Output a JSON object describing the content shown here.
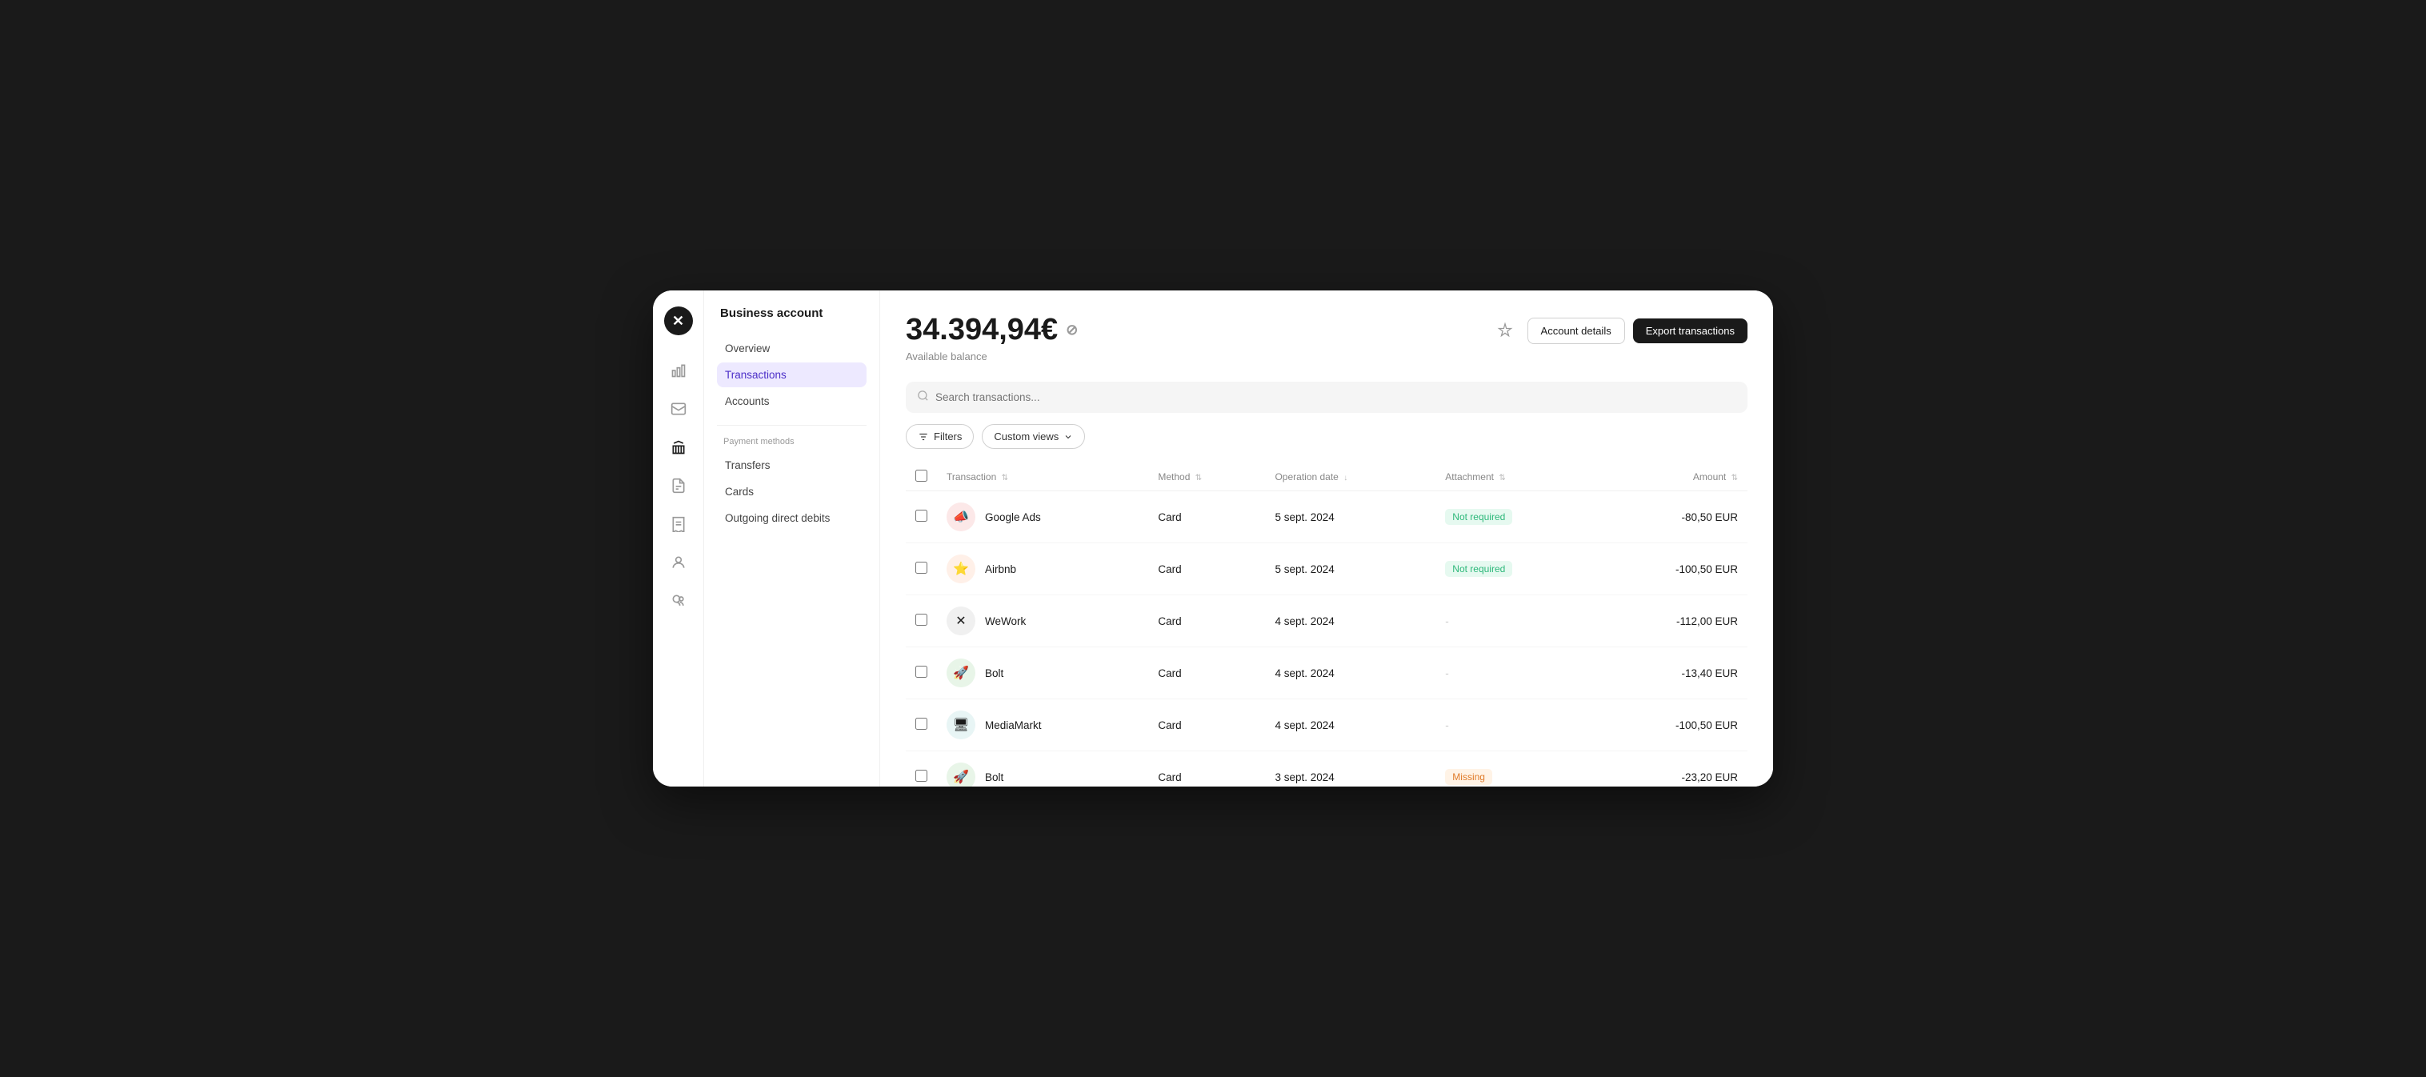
{
  "app": {
    "logo": "✕",
    "account_title": "Business account"
  },
  "rail_icons": [
    {
      "name": "chart-icon",
      "symbol": "📊",
      "active": false
    },
    {
      "name": "mail-icon",
      "symbol": "✉",
      "active": false
    },
    {
      "name": "bank-icon",
      "symbol": "🏦",
      "active": true
    },
    {
      "name": "file-icon",
      "symbol": "📋",
      "active": false
    },
    {
      "name": "receipt-icon",
      "symbol": "🧾",
      "active": false
    },
    {
      "name": "user-icon",
      "symbol": "👤",
      "active": false
    },
    {
      "name": "coins-icon",
      "symbol": "💰",
      "active": false
    }
  ],
  "sidebar": {
    "header": "Business account",
    "section1_label": "",
    "nav_items": [
      {
        "label": "Overview",
        "active": false,
        "id": "overview"
      },
      {
        "label": "Transactions",
        "active": true,
        "id": "transactions"
      },
      {
        "label": "Accounts",
        "active": false,
        "id": "accounts"
      }
    ],
    "section2_label": "Payment methods",
    "payment_items": [
      {
        "label": "Transfers",
        "active": false,
        "id": "transfers"
      },
      {
        "label": "Cards",
        "active": false,
        "id": "cards"
      },
      {
        "label": "Outgoing direct debits",
        "active": false,
        "id": "direct-debits"
      }
    ]
  },
  "main": {
    "balance": "34.394,94€",
    "balance_label": "Available balance",
    "btn_account_details": "Account details",
    "btn_export": "Export transactions",
    "search_placeholder": "Search transactions...",
    "btn_filters": "Filters",
    "btn_custom_views": "Custom views",
    "table": {
      "columns": [
        {
          "label": "Transaction",
          "sort": true
        },
        {
          "label": "Method",
          "sort": true
        },
        {
          "label": "Operation date",
          "sort": true,
          "sort_direction": "desc"
        },
        {
          "label": "Attachment",
          "sort": true
        },
        {
          "label": "Amount",
          "sort": true
        }
      ],
      "rows": [
        {
          "id": 1,
          "merchant": "Google Ads",
          "icon_bg": "#fce8e8",
          "icon": "📣",
          "method": "Card",
          "date": "5 sept. 2024",
          "attachment": "Not required",
          "attachment_type": "not-required",
          "amount": "-80,50 EUR"
        },
        {
          "id": 2,
          "merchant": "Airbnb",
          "icon_bg": "#fff0e8",
          "icon": "⭐",
          "method": "Card",
          "date": "5 sept. 2024",
          "attachment": "Not required",
          "attachment_type": "not-required",
          "amount": "-100,50 EUR"
        },
        {
          "id": 3,
          "merchant": "WeWork",
          "icon_bg": "#f0f0f0",
          "icon": "✕",
          "method": "Card",
          "date": "4 sept. 2024",
          "attachment": "-",
          "attachment_type": "dash",
          "amount": "-112,00 EUR"
        },
        {
          "id": 4,
          "merchant": "Bolt",
          "icon_bg": "#e8f5e8",
          "icon": "🚀",
          "method": "Card",
          "date": "4 sept. 2024",
          "attachment": "-",
          "attachment_type": "dash",
          "amount": "-13,40 EUR"
        },
        {
          "id": 5,
          "merchant": "MediaMarkt",
          "icon_bg": "#e8f5f5",
          "icon": "🖥",
          "method": "Card",
          "date": "4 sept. 2024",
          "attachment": "-",
          "attachment_type": "dash",
          "amount": "-100,50 EUR"
        },
        {
          "id": 6,
          "merchant": "Bolt",
          "icon_bg": "#e8f5e8",
          "icon": "🚀",
          "method": "Card",
          "date": "3 sept. 2024",
          "attachment": "Missing",
          "attachment_type": "missing",
          "amount": "-23,20 EUR"
        }
      ]
    }
  }
}
